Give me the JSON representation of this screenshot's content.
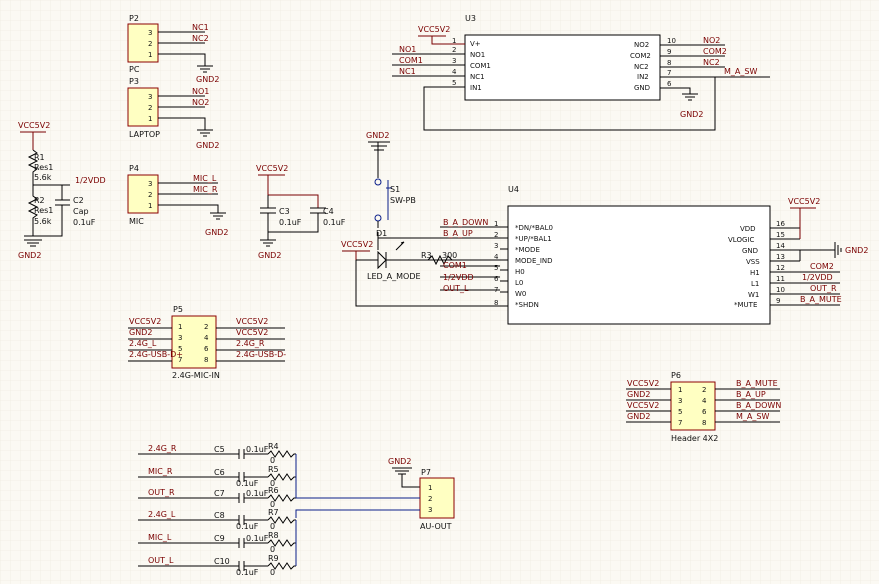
{
  "power": {
    "vcc": "VCC5V2",
    "gnd": "GND2"
  },
  "p2": {
    "des": "P2",
    "name": "PC",
    "pins": [
      "3",
      "2",
      "1"
    ],
    "nets": [
      "NC1",
      "NC2",
      ""
    ]
  },
  "p3": {
    "des": "P3",
    "name": "LAPTOP",
    "pins": [
      "3",
      "2",
      "1"
    ],
    "nets": [
      "NO1",
      "NO2",
      ""
    ]
  },
  "p4": {
    "des": "P4",
    "name": "MIC",
    "pins": [
      "3",
      "2",
      "1"
    ],
    "nets": [
      "MIC_L",
      "MIC_R",
      ""
    ]
  },
  "divider": {
    "r1": "R1",
    "r1_type": "Res1",
    "r1_val": "5.6k",
    "r2": "R2",
    "r2_type": "Res1",
    "r2_val": "5.6k",
    "c2": "C2",
    "c2_type": "Cap",
    "c2_val": "0.1uF",
    "net": "1/2VDD"
  },
  "caps": {
    "c3": "C3",
    "c3_val": "0.1uF",
    "c4": "C4",
    "c4_val": "0.1uF"
  },
  "u3": {
    "des": "U3",
    "left_pins": [
      [
        "1",
        "V+"
      ],
      [
        "2",
        "NO1"
      ],
      [
        "3",
        "COM1"
      ],
      [
        "4",
        "NC1"
      ],
      [
        "5",
        "IN1"
      ]
    ],
    "right_pins": [
      [
        "10",
        "NO2"
      ],
      [
        "9",
        "COM2"
      ],
      [
        "8",
        "NC2"
      ],
      [
        "7",
        "IN2"
      ],
      [
        "6",
        "GND"
      ]
    ],
    "left_nets": [
      "NO1",
      "COM1",
      "NC1"
    ],
    "right_nets": [
      "NO2",
      "COM2",
      "NC2",
      "M_A_SW"
    ]
  },
  "switch": {
    "des": "S1",
    "name": "SW-PB"
  },
  "led": {
    "des": "D1",
    "name": "LED_A_MODE",
    "r3": "R3",
    "r3_val": "300"
  },
  "u4": {
    "des": "U4",
    "left_pins": [
      [
        "1",
        "*DN/*BAL0"
      ],
      [
        "2",
        "*UP/*BAL1"
      ],
      [
        "3",
        "*MODE"
      ],
      [
        "4",
        "MODE_IND"
      ],
      [
        "5",
        "H0"
      ],
      [
        "6",
        "L0"
      ],
      [
        "7",
        "W0"
      ],
      [
        "8",
        "*SHDN"
      ]
    ],
    "right_pins": [
      [
        "16",
        "VDD"
      ],
      [
        "15",
        "VLOGIC"
      ],
      [
        "14",
        "GND"
      ],
      [
        "13",
        "VSS"
      ],
      [
        "12",
        "H1"
      ],
      [
        "11",
        "L1"
      ],
      [
        "10",
        "W1"
      ],
      [
        "9",
        "*MUTE"
      ]
    ],
    "left_nets": [
      "B_A_DOWN",
      "B_A_UP",
      "COM1",
      "1/2VDD",
      "OUT_L"
    ],
    "right_nets": [
      "COM2",
      "1/2VDD",
      "OUT_R",
      "B_A_MUTE"
    ]
  },
  "p5": {
    "des": "P5",
    "name": "2.4G-MIC-IN",
    "left_pins": [
      "1",
      "3",
      "5",
      "7"
    ],
    "right_pins": [
      "2",
      "4",
      "6",
      "8"
    ],
    "left_nets": [
      "VCC5V2",
      "GND2",
      "2.4G_L",
      "2.4G-USB-D+"
    ],
    "right_nets": [
      "VCC5V2",
      "VCC5V2",
      "2.4G_R",
      "2.4G-USB-D-"
    ]
  },
  "p6": {
    "des": "P6",
    "name": "Header 4X2",
    "left_pins": [
      "1",
      "3",
      "5",
      "7"
    ],
    "right_pins": [
      "2",
      "4",
      "6",
      "8"
    ],
    "left_nets": [
      "VCC5V2",
      "GND2",
      "VCC5V2",
      "GND2"
    ],
    "right_nets": [
      "B_A_MUTE",
      "B_A_UP",
      "B_A_DOWN",
      "M_A_SW"
    ]
  },
  "p7": {
    "des": "P7",
    "name": "AU-OUT",
    "pins": [
      "1",
      "2",
      "3"
    ]
  },
  "mixer": [
    {
      "net": "2.4G_R",
      "c": "C5",
      "cv": "0.1uF",
      "r": "R4",
      "rv": "0"
    },
    {
      "net": "MIC_R",
      "c": "C6",
      "cv": "0.1uF",
      "r": "R5",
      "rv": "0"
    },
    {
      "net": "OUT_R",
      "c": "C7",
      "cv": "0.1uF",
      "r": "R6",
      "rv": "0"
    },
    {
      "net": "2.4G_L",
      "c": "C8",
      "cv": "0.1uF",
      "r": "R7",
      "rv": "0"
    },
    {
      "net": "MIC_L",
      "c": "C9",
      "cv": "0.1uF",
      "r": "R8",
      "rv": "0"
    },
    {
      "net": "OUT_L",
      "c": "C10",
      "cv": "0.1uF",
      "r": "R9",
      "rv": "0"
    }
  ]
}
